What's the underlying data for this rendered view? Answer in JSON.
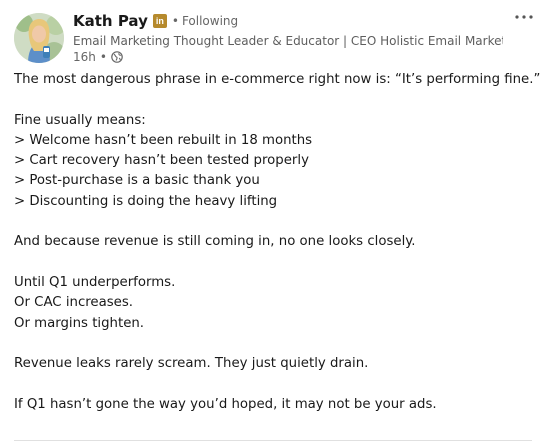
{
  "author": {
    "name": "Kath Pay",
    "badge": "in",
    "follow_status": "Following",
    "headline": "Email Marketing Thought Leader & Educator | CEO Holistic Email Marketing | ...",
    "time": "16h",
    "visibility_icon": "globe-icon"
  },
  "menu": {
    "icon": "more-horizontal-icon",
    "label": "···"
  },
  "post": {
    "lines": [
      "The most dangerous phrase in e-commerce right now is: “It’s performing fine.”",
      "",
      "Fine usually means:",
      "> Welcome hasn’t been rebuilt in 18 months",
      "> Cart recovery hasn’t been tested properly",
      "> Post-purchase is a basic thank you",
      "> Discounting is doing the heavy lifting",
      "",
      "And because revenue is still coming in, no one looks closely.",
      "",
      "Until Q1 underperforms.",
      "Or CAC increases.",
      "Or margins tighten.",
      "",
      "Revenue leaks rarely scream. They just quietly drain.",
      "",
      "If Q1 hasn’t gone the way you’d hoped, it may not be your ads."
    ]
  },
  "colors": {
    "badge": "#b68a2d",
    "text": "#191919",
    "muted": "#666666"
  }
}
